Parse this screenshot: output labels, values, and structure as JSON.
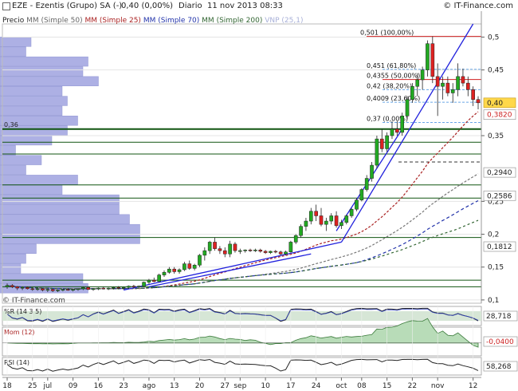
{
  "header": {
    "symbol": "EZE - Ezentis (Grupo) SA (-)",
    "last": "0,40 (0,00%)",
    "period": "Diario",
    "datetime": "11 nov 2013 08:33",
    "brand": "© IT-Finance.com"
  },
  "legend": {
    "price": "Precio",
    "ma50": "MM (Simple 50)",
    "ma25": "MM (Simple 25)",
    "ma70": "MM (Simple 70)",
    "ma200": "MM (Simple 200)",
    "vnp": "VNP (25,1)"
  },
  "colors": {
    "up": "#22aa22",
    "down": "#dd2222",
    "ma50": "#777777",
    "ma25": "#aa2222",
    "ma70": "#2233aa",
    "ma200": "#336633",
    "trend": "#2222dd",
    "support": "#115511",
    "volbar": "#9fa3e0"
  },
  "watermark": "© IT-Finance.com",
  "chart_data": {
    "type": "candlestick",
    "ylim": [
      0.095,
      0.52
    ],
    "yticks": [
      {
        "v": 0.5,
        "label": "0,5"
      },
      {
        "v": 0.45,
        "label": "0,45"
      },
      {
        "v": 0.35,
        "label": "0,35"
      },
      {
        "v": 0.25,
        "label": "0,25"
      },
      {
        "v": 0.2,
        "label": "0,2"
      },
      {
        "v": 0.15,
        "label": "0,15"
      },
      {
        "v": 0.1,
        "label": "0,1"
      }
    ],
    "xticks": [
      {
        "i": 0,
        "label": "18"
      },
      {
        "i": 5,
        "label": "25"
      },
      {
        "i": 8,
        "label": "jul"
      },
      {
        "i": 13,
        "label": "09"
      },
      {
        "i": 18,
        "label": "16"
      },
      {
        "i": 23,
        "label": "23"
      },
      {
        "i": 28,
        "label": "ago"
      },
      {
        "i": 33,
        "label": "13"
      },
      {
        "i": 38,
        "label": "20"
      },
      {
        "i": 43,
        "label": "27"
      },
      {
        "i": 46,
        "label": "sep"
      },
      {
        "i": 51,
        "label": "10"
      },
      {
        "i": 56,
        "label": "17"
      },
      {
        "i": 61,
        "label": "24"
      },
      {
        "i": 66,
        "label": "oct"
      },
      {
        "i": 70,
        "label": "08"
      },
      {
        "i": 75,
        "label": "15"
      },
      {
        "i": 80,
        "label": "22"
      },
      {
        "i": 85,
        "label": "nov"
      },
      {
        "i": 92,
        "label": "12"
      }
    ],
    "candles": [
      [
        0.12,
        0.125,
        0.117,
        0.122
      ],
      [
        0.122,
        0.124,
        0.118,
        0.12
      ],
      [
        0.12,
        0.121,
        0.115,
        0.118
      ],
      [
        0.118,
        0.12,
        0.115,
        0.119
      ],
      [
        0.119,
        0.12,
        0.116,
        0.117
      ],
      [
        0.117,
        0.118,
        0.114,
        0.116
      ],
      [
        0.116,
        0.118,
        0.114,
        0.117
      ],
      [
        0.117,
        0.118,
        0.113,
        0.115
      ],
      [
        0.115,
        0.117,
        0.112,
        0.116
      ],
      [
        0.116,
        0.117,
        0.112,
        0.114
      ],
      [
        0.114,
        0.116,
        0.112,
        0.115
      ],
      [
        0.115,
        0.117,
        0.113,
        0.116
      ],
      [
        0.116,
        0.118,
        0.114,
        0.115
      ],
      [
        0.115,
        0.117,
        0.113,
        0.116
      ],
      [
        0.116,
        0.118,
        0.114,
        0.117
      ],
      [
        0.117,
        0.12,
        0.115,
        0.119
      ],
      [
        0.119,
        0.12,
        0.115,
        0.116
      ],
      [
        0.116,
        0.118,
        0.114,
        0.117
      ],
      [
        0.117,
        0.119,
        0.115,
        0.118
      ],
      [
        0.118,
        0.12,
        0.116,
        0.117
      ],
      [
        0.117,
        0.119,
        0.115,
        0.118
      ],
      [
        0.118,
        0.12,
        0.116,
        0.119
      ],
      [
        0.119,
        0.121,
        0.116,
        0.118
      ],
      [
        0.118,
        0.12,
        0.116,
        0.119
      ],
      [
        0.119,
        0.122,
        0.117,
        0.121
      ],
      [
        0.121,
        0.123,
        0.118,
        0.12
      ],
      [
        0.12,
        0.122,
        0.118,
        0.121
      ],
      [
        0.121,
        0.128,
        0.12,
        0.127
      ],
      [
        0.127,
        0.132,
        0.124,
        0.13
      ],
      [
        0.13,
        0.134,
        0.127,
        0.128
      ],
      [
        0.128,
        0.14,
        0.127,
        0.138
      ],
      [
        0.138,
        0.145,
        0.135,
        0.142
      ],
      [
        0.142,
        0.15,
        0.14,
        0.147
      ],
      [
        0.147,
        0.15,
        0.14,
        0.143
      ],
      [
        0.143,
        0.148,
        0.14,
        0.146
      ],
      [
        0.146,
        0.158,
        0.144,
        0.155
      ],
      [
        0.155,
        0.16,
        0.146,
        0.148
      ],
      [
        0.148,
        0.155,
        0.145,
        0.153
      ],
      [
        0.153,
        0.17,
        0.15,
        0.168
      ],
      [
        0.168,
        0.18,
        0.16,
        0.175
      ],
      [
        0.175,
        0.19,
        0.17,
        0.188
      ],
      [
        0.188,
        0.195,
        0.175,
        0.178
      ],
      [
        0.178,
        0.182,
        0.17,
        0.175
      ],
      [
        0.175,
        0.18,
        0.165,
        0.17
      ],
      [
        0.17,
        0.19,
        0.165,
        0.185
      ],
      [
        0.185,
        0.188,
        0.172,
        0.175
      ],
      [
        0.175,
        0.178,
        0.17,
        0.175
      ],
      [
        0.175,
        0.177,
        0.172,
        0.176
      ],
      [
        0.176,
        0.178,
        0.173,
        0.175
      ],
      [
        0.175,
        0.178,
        0.173,
        0.176
      ],
      [
        0.176,
        0.178,
        0.172,
        0.174
      ],
      [
        0.174,
        0.176,
        0.17,
        0.172
      ],
      [
        0.172,
        0.175,
        0.17,
        0.174
      ],
      [
        0.174,
        0.176,
        0.171,
        0.173
      ],
      [
        0.173,
        0.175,
        0.168,
        0.17
      ],
      [
        0.17,
        0.175,
        0.168,
        0.173
      ],
      [
        0.173,
        0.19,
        0.172,
        0.188
      ],
      [
        0.188,
        0.2,
        0.185,
        0.198
      ],
      [
        0.198,
        0.215,
        0.195,
        0.212
      ],
      [
        0.212,
        0.225,
        0.205,
        0.22
      ],
      [
        0.22,
        0.24,
        0.215,
        0.235
      ],
      [
        0.235,
        0.245,
        0.22,
        0.228
      ],
      [
        0.228,
        0.24,
        0.212,
        0.215
      ],
      [
        0.215,
        0.225,
        0.205,
        0.22
      ],
      [
        0.22,
        0.232,
        0.215,
        0.228
      ],
      [
        0.228,
        0.235,
        0.21,
        0.213
      ],
      [
        0.213,
        0.222,
        0.208,
        0.218
      ],
      [
        0.218,
        0.23,
        0.215,
        0.228
      ],
      [
        0.228,
        0.24,
        0.225,
        0.238
      ],
      [
        0.238,
        0.255,
        0.235,
        0.252
      ],
      [
        0.252,
        0.27,
        0.25,
        0.268
      ],
      [
        0.268,
        0.29,
        0.265,
        0.285
      ],
      [
        0.285,
        0.31,
        0.28,
        0.305
      ],
      [
        0.305,
        0.35,
        0.3,
        0.345
      ],
      [
        0.345,
        0.36,
        0.325,
        0.33
      ],
      [
        0.33,
        0.355,
        0.325,
        0.35
      ],
      [
        0.35,
        0.372,
        0.345,
        0.36
      ],
      [
        0.36,
        0.372,
        0.35,
        0.355
      ],
      [
        0.355,
        0.385,
        0.35,
        0.38
      ],
      [
        0.38,
        0.41,
        0.375,
        0.405
      ],
      [
        0.405,
        0.43,
        0.4,
        0.425
      ],
      [
        0.425,
        0.445,
        0.41,
        0.435
      ],
      [
        0.435,
        0.455,
        0.42,
        0.45
      ],
      [
        0.45,
        0.495,
        0.44,
        0.49
      ],
      [
        0.49,
        0.501,
        0.43,
        0.44
      ],
      [
        0.44,
        0.46,
        0.38,
        0.425
      ],
      [
        0.425,
        0.44,
        0.405,
        0.43
      ],
      [
        0.43,
        0.44,
        0.41,
        0.415
      ],
      [
        0.415,
        0.43,
        0.4,
        0.42
      ],
      [
        0.42,
        0.46,
        0.41,
        0.44
      ],
      [
        0.44,
        0.452,
        0.425,
        0.43
      ],
      [
        0.43,
        0.44,
        0.41,
        0.42
      ],
      [
        0.42,
        0.425,
        0.395,
        0.405
      ],
      [
        0.405,
        0.41,
        0.39,
        0.4
      ]
    ],
    "fib": [
      {
        "v": 0.501,
        "label": "0,501 (100,00%)"
      },
      {
        "v": 0.451,
        "label": "0,451 (61,80%)"
      },
      {
        "v": 0.4355,
        "label": "0,4355 (50,00%)"
      },
      {
        "v": 0.42,
        "label": "0,42 (38,20%)"
      },
      {
        "v": 0.4009,
        "label": "0,4009 (23,60%)"
      },
      {
        "v": 0.37,
        "label": "0,37 (0,00%)"
      }
    ],
    "hlines": [
      0.36,
      0.34,
      0.322,
      0.275,
      0.255,
      0.195,
      0.13,
      0.12
    ],
    "right_labels": [
      {
        "v": 0.4,
        "label": "0,40",
        "bg": "#ffd84a"
      },
      {
        "v": 0.382,
        "label": "0,3820",
        "bg": "#ffffff"
      },
      {
        "v": 0.294,
        "label": "0,2940",
        "bg": "#ffffff"
      },
      {
        "v": 0.2586,
        "label": "0,2586",
        "bg": "#ffffff"
      },
      {
        "v": 0.1812,
        "label": "0,1812",
        "bg": "#ffffff"
      }
    ],
    "left_level_label": {
      "v": 0.36,
      "label": "0,36"
    },
    "volume_profile": [
      [
        0.485,
        0.5,
        0.06
      ],
      [
        0.47,
        0.485,
        0.05
      ],
      [
        0.455,
        0.47,
        0.17
      ],
      [
        0.44,
        0.455,
        0.16
      ],
      [
        0.425,
        0.44,
        0.19
      ],
      [
        0.41,
        0.425,
        0.12
      ],
      [
        0.395,
        0.41,
        0.13
      ],
      [
        0.38,
        0.395,
        0.12
      ],
      [
        0.365,
        0.38,
        0.15
      ],
      [
        0.35,
        0.365,
        0.13
      ],
      [
        0.335,
        0.35,
        0.1
      ],
      [
        0.32,
        0.335,
        0.03
      ],
      [
        0.305,
        0.32,
        0.08
      ],
      [
        0.29,
        0.305,
        0.05
      ],
      [
        0.275,
        0.29,
        0.15
      ],
      [
        0.26,
        0.275,
        0.12
      ],
      [
        0.245,
        0.26,
        0.23
      ],
      [
        0.23,
        0.245,
        0.23
      ],
      [
        0.215,
        0.23,
        0.25
      ],
      [
        0.2,
        0.215,
        0.27
      ],
      [
        0.185,
        0.2,
        0.27
      ],
      [
        0.17,
        0.185,
        0.07
      ],
      [
        0.155,
        0.17,
        0.05
      ],
      [
        0.14,
        0.155,
        0.04
      ],
      [
        0.125,
        0.14,
        0.16
      ],
      [
        0.11,
        0.125,
        0.17
      ]
    ],
    "panels": [
      {
        "name": "williams",
        "label": "%R (14 3 5)",
        "value": "28,718"
      },
      {
        "name": "momentum",
        "label": "Mom (12)",
        "value": "-0,0400"
      },
      {
        "name": "rsi",
        "label": "RSI (14)",
        "value": "58,268"
      }
    ]
  }
}
